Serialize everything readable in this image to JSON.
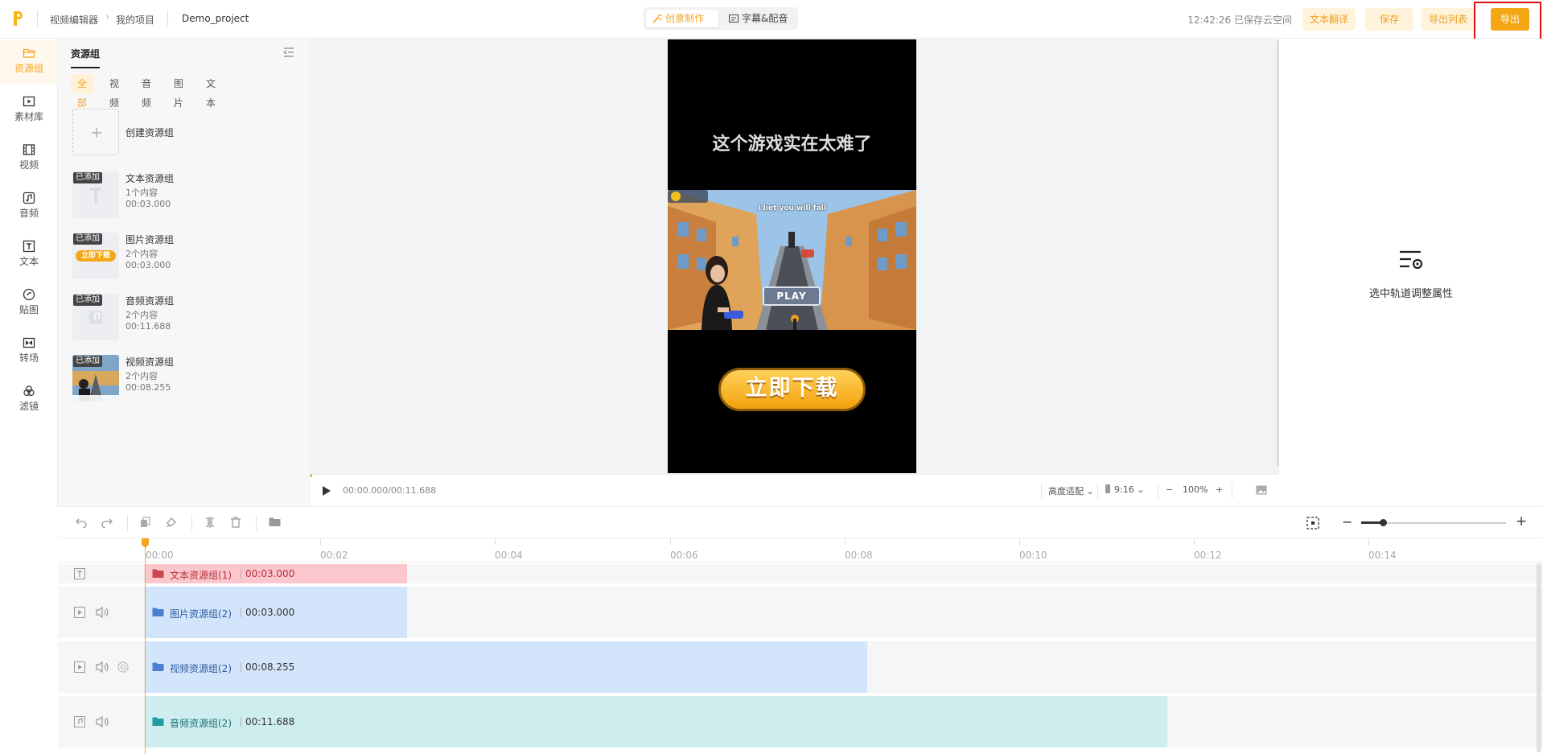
{
  "app": {
    "logo_letter": "P",
    "breadcrumb": [
      "视频编辑器",
      "我的项目"
    ],
    "project_name": "Demo_project"
  },
  "mode_tabs": [
    {
      "label": "创意制作",
      "active": true
    },
    {
      "label": "字幕&配音",
      "active": false
    }
  ],
  "save_status": "12:42:26 已保存云空间",
  "actions": {
    "translate": "文本翻译",
    "save": "保存",
    "export_list": "导出列表",
    "export": "导出"
  },
  "rail": [
    {
      "label": "资源组",
      "icon": "folder-icon",
      "active": true
    },
    {
      "label": "素材库",
      "icon": "media-library-icon"
    },
    {
      "label": "视频",
      "icon": "film-icon"
    },
    {
      "label": "音频",
      "icon": "music-note-icon"
    },
    {
      "label": "文本",
      "icon": "text-icon"
    },
    {
      "label": "贴图",
      "icon": "sticker-icon"
    },
    {
      "label": "转场",
      "icon": "transition-icon"
    },
    {
      "label": "滤镜",
      "icon": "filter-icon"
    }
  ],
  "panel": {
    "title": "资源组",
    "filters": [
      "全部",
      "视频",
      "音频",
      "图片",
      "文本"
    ],
    "create_label": "创建资源组",
    "badge": "已添加",
    "items": [
      {
        "name": "文本资源组",
        "count": "1个内容",
        "duration": "00:03.000"
      },
      {
        "name": "图片资源组",
        "count": "2个内容",
        "duration": "00:03.000",
        "thumb_text": "立即下载"
      },
      {
        "name": "音频资源组",
        "count": "2个内容",
        "duration": "00:11.688"
      },
      {
        "name": "视频资源组",
        "count": "2个内容",
        "duration": "00:08.255"
      }
    ]
  },
  "preview": {
    "title_text": "这个游戏实在太难了",
    "game_caption": "I bet you will fall",
    "play_label": "PLAY",
    "download_label": "立即下载"
  },
  "player": {
    "timecode": "00:00.000/00:11.688",
    "fit": "高度适配",
    "ratio": "9:16",
    "zoom": "100%"
  },
  "props": {
    "hint": "选中轨道调整属性"
  },
  "ruler": [
    "00:00",
    "00:02",
    "00:04",
    "00:06",
    "00:08",
    "00:10",
    "00:12",
    "00:14"
  ],
  "tracks": [
    {
      "label": "文本资源组(1)",
      "duration": "00:03.000"
    },
    {
      "label": "图片资源组(2)",
      "duration": "00:03.000"
    },
    {
      "label": "视频资源组(2)",
      "duration": "00:08.255"
    },
    {
      "label": "音频资源组(2)",
      "duration": "00:11.688"
    }
  ]
}
